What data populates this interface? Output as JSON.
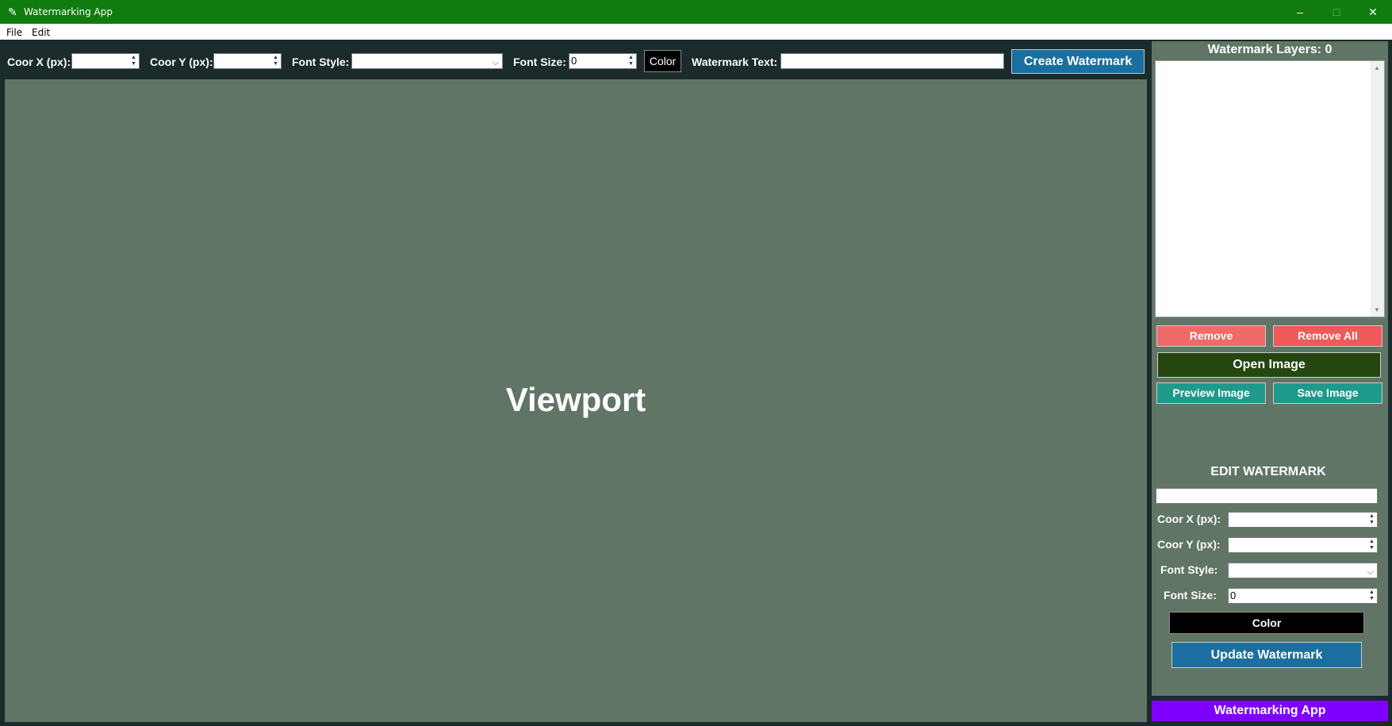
{
  "window": {
    "title": "Watermarking App",
    "minimize_glyph": "–",
    "maximize_glyph": "□",
    "close_glyph": "✕"
  },
  "menu": {
    "file": "File",
    "edit": "Edit"
  },
  "toolbar": {
    "coor_x_label": "Coor X (px):",
    "coor_x_value": "",
    "coor_y_label": "Coor Y (px):",
    "coor_y_value": "",
    "font_style_label": "Font Style:",
    "font_style_value": "",
    "font_size_label": "Font Size:",
    "font_size_value": "0",
    "color_label": "Color",
    "watermark_text_label": "Watermark Text:",
    "watermark_text_value": "",
    "create_label": "Create Watermark"
  },
  "viewport": {
    "label": "Viewport"
  },
  "sidebar": {
    "layers_title": "Watermark Layers: 0",
    "remove_label": "Remove",
    "remove_all_label": "Remove All",
    "open_image_label": "Open Image",
    "preview_image_label": "Preview Image",
    "save_image_label": "Save Image",
    "edit_title": "EDIT WATERMARK",
    "edit_text_value": "",
    "coor_x_label": "Coor X (px):",
    "coor_x_value": "",
    "coor_y_label": "Coor Y (px):",
    "coor_y_value": "",
    "font_style_label": "Font Style:",
    "font_style_value": "",
    "font_size_label": "Font Size:",
    "font_size_value": "0",
    "color_label": "Color",
    "update_label": "Update Watermark",
    "footer": "Watermarking App"
  },
  "colors": {
    "titlebar": "#107c10",
    "viewport": "#607565",
    "create_button": "#1a6fa0",
    "remove_button": "#f06a6a",
    "remove_all_button": "#f05a5a",
    "open_image_button": "#25460f",
    "teal_button": "#1f9a8a",
    "footer": "#8000ff"
  }
}
